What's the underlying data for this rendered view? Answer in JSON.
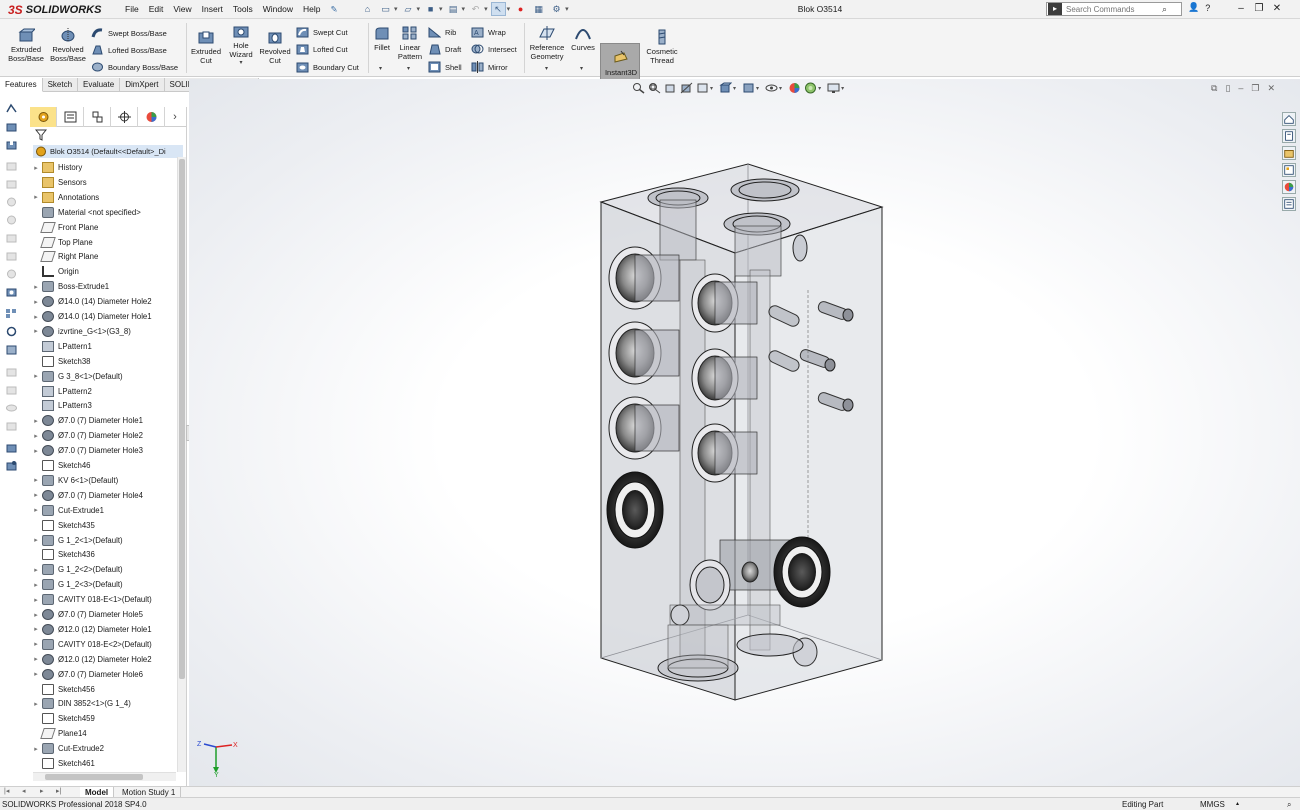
{
  "app": {
    "logo_prefix": "3S",
    "logo_text": "SOLIDWORKS",
    "document_title": "Blok O3514"
  },
  "menu": [
    "File",
    "Edit",
    "View",
    "Insert",
    "Tools",
    "Window",
    "Help"
  ],
  "search": {
    "placeholder": "Search Commands"
  },
  "help": {
    "label": "?"
  },
  "ribbon": {
    "extruded_boss": "Extruded\nBoss/Base",
    "revolved_boss": "Revolved\nBoss/Base",
    "swept_boss": "Swept Boss/Base",
    "lofted_boss": "Lofted Boss/Base",
    "boundary_boss": "Boundary Boss/Base",
    "extruded_cut": "Extruded\nCut",
    "hole_wizard": "Hole\nWizard",
    "revolved_cut": "Revolved\nCut",
    "swept_cut": "Swept Cut",
    "lofted_cut": "Lofted Cut",
    "boundary_cut": "Boundary Cut",
    "fillet": "Fillet",
    "linear_pattern": "Linear\nPattern",
    "rib": "Rib",
    "draft": "Draft",
    "shell": "Shell",
    "wrap": "Wrap",
    "intersect": "Intersect",
    "mirror": "Mirror",
    "reference_geometry": "Reference\nGeometry",
    "curves": "Curves",
    "instant3d": "Instant3D",
    "cosmetic_thread": "Cosmetic\nThread"
  },
  "cm_tabs": [
    "Features",
    "Sketch",
    "Evaluate",
    "DimXpert",
    "SOLIDWORKS Add-Ins"
  ],
  "feature_tree": {
    "root": "Blok O3514  (Default<<Default>_Di",
    "items": [
      {
        "label": "History",
        "icon": "folder",
        "expand": true
      },
      {
        "label": "Sensors",
        "icon": "folder",
        "expand": false
      },
      {
        "label": "Annotations",
        "icon": "folder",
        "expand": true
      },
      {
        "label": "Material <not specified>",
        "icon": "feat",
        "expand": false
      },
      {
        "label": "Front Plane",
        "icon": "plane",
        "expand": false
      },
      {
        "label": "Top Plane",
        "icon": "plane",
        "expand": false
      },
      {
        "label": "Right Plane",
        "icon": "plane",
        "expand": false
      },
      {
        "label": "Origin",
        "icon": "origin",
        "expand": false
      },
      {
        "label": "Boss-Extrude1",
        "icon": "feat",
        "expand": true
      },
      {
        "label": "Ø14.0 (14) Diameter Hole2",
        "icon": "hole",
        "expand": true
      },
      {
        "label": "Ø14.0 (14) Diameter Hole1",
        "icon": "hole",
        "expand": true
      },
      {
        "label": "izvrtine_G<1>(G3_8)",
        "icon": "hole",
        "expand": true
      },
      {
        "label": "LPattern1",
        "icon": "pattern",
        "expand": false
      },
      {
        "label": "Sketch38",
        "icon": "sketch",
        "expand": false
      },
      {
        "label": "G 3_8<1>(Default)",
        "icon": "feat",
        "expand": true
      },
      {
        "label": "LPattern2",
        "icon": "pattern",
        "expand": false
      },
      {
        "label": "LPattern3",
        "icon": "pattern",
        "expand": false
      },
      {
        "label": "Ø7.0 (7) Diameter Hole1",
        "icon": "hole",
        "expand": true
      },
      {
        "label": "Ø7.0 (7) Diameter Hole2",
        "icon": "hole",
        "expand": true
      },
      {
        "label": "Ø7.0 (7) Diameter Hole3",
        "icon": "hole",
        "expand": true
      },
      {
        "label": "Sketch46",
        "icon": "sketch",
        "expand": false
      },
      {
        "label": "KV 6<1>(Default)",
        "icon": "feat",
        "expand": true
      },
      {
        "label": "Ø7.0 (7) Diameter Hole4",
        "icon": "hole",
        "expand": true
      },
      {
        "label": "Cut-Extrude1",
        "icon": "feat",
        "expand": true
      },
      {
        "label": "Sketch435",
        "icon": "sketch",
        "expand": false
      },
      {
        "label": "G 1_2<1>(Default)",
        "icon": "feat",
        "expand": true
      },
      {
        "label": "Sketch436",
        "icon": "sketch",
        "expand": false
      },
      {
        "label": "G 1_2<2>(Default)",
        "icon": "feat",
        "expand": true
      },
      {
        "label": "G 1_2<3>(Default)",
        "icon": "feat",
        "expand": true
      },
      {
        "label": "CAVITY 018-E<1>(Default)",
        "icon": "feat",
        "expand": true
      },
      {
        "label": "Ø7.0 (7) Diameter Hole5",
        "icon": "hole",
        "expand": true
      },
      {
        "label": "Ø12.0 (12) Diameter Hole1",
        "icon": "hole",
        "expand": true
      },
      {
        "label": "CAVITY 018-E<2>(Default)",
        "icon": "feat",
        "expand": true
      },
      {
        "label": "Ø12.0 (12) Diameter Hole2",
        "icon": "hole",
        "expand": true
      },
      {
        "label": "Ø7.0 (7) Diameter Hole6",
        "icon": "hole",
        "expand": true
      },
      {
        "label": "Sketch456",
        "icon": "sketch",
        "expand": false
      },
      {
        "label": "DIN 3852<1>(G 1_4)",
        "icon": "feat",
        "expand": true
      },
      {
        "label": "Sketch459",
        "icon": "sketch",
        "expand": false
      },
      {
        "label": "Plane14",
        "icon": "plane",
        "expand": false
      },
      {
        "label": "Cut-Extrude2",
        "icon": "feat",
        "expand": true
      },
      {
        "label": "Sketch461",
        "icon": "sketch",
        "expand": false
      }
    ]
  },
  "triad": {
    "z": "Z",
    "x": "X",
    "y": "Y"
  },
  "bottom_tabs": [
    "Model",
    "Motion Study 1"
  ],
  "status": {
    "left": "SOLIDWORKS Professional 2018 SP4.0",
    "mode": "Editing Part",
    "units": "MMGS"
  },
  "colors": {
    "accent_red": "#d0021b",
    "selection": "#d9e6f5",
    "instant3d_bg": "#a9a9a9"
  }
}
